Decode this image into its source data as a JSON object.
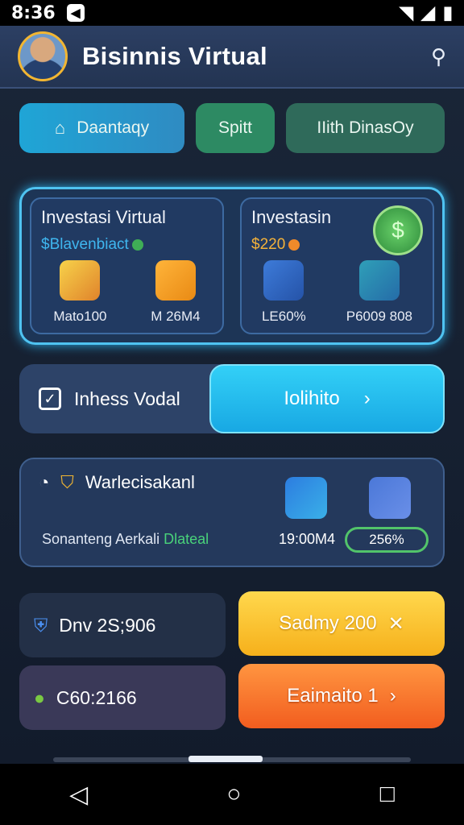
{
  "status": {
    "time": "8:36"
  },
  "header": {
    "title": "Bisinnis Virtual",
    "search_icon": "search-icon"
  },
  "chips": [
    {
      "label": "Daantaqy"
    },
    {
      "label": "Spitt"
    },
    {
      "label": "IIith DinasOy"
    }
  ],
  "invest": {
    "card1": {
      "title": "Investasi Virtual",
      "subtitle": "$Blavenbiact",
      "item1": "Mato100",
      "item2": "M 26M4"
    },
    "card2": {
      "title": "Investasin",
      "value": "$220",
      "item1": "LE60%",
      "item2": "P6009 808"
    }
  },
  "action": {
    "label": "Inhess Vodal",
    "button": "Iolihito"
  },
  "market": {
    "title": "Warlecisakanl",
    "text": "Sonanteng Aerkali",
    "text_green": "Dlateal",
    "value": "19:00M4",
    "pct": "256%"
  },
  "stats": [
    {
      "value": "Dnv 2S;906"
    },
    {
      "value": "C60:2166"
    }
  ],
  "buttons": {
    "yellow": "Sadmy 200",
    "orange": "Eaimaito 1"
  },
  "colors": {
    "accent_cyan": "#33d0f7",
    "yellow": "#f6b01b",
    "orange": "#f25d1f",
    "green": "#2d8a63"
  }
}
